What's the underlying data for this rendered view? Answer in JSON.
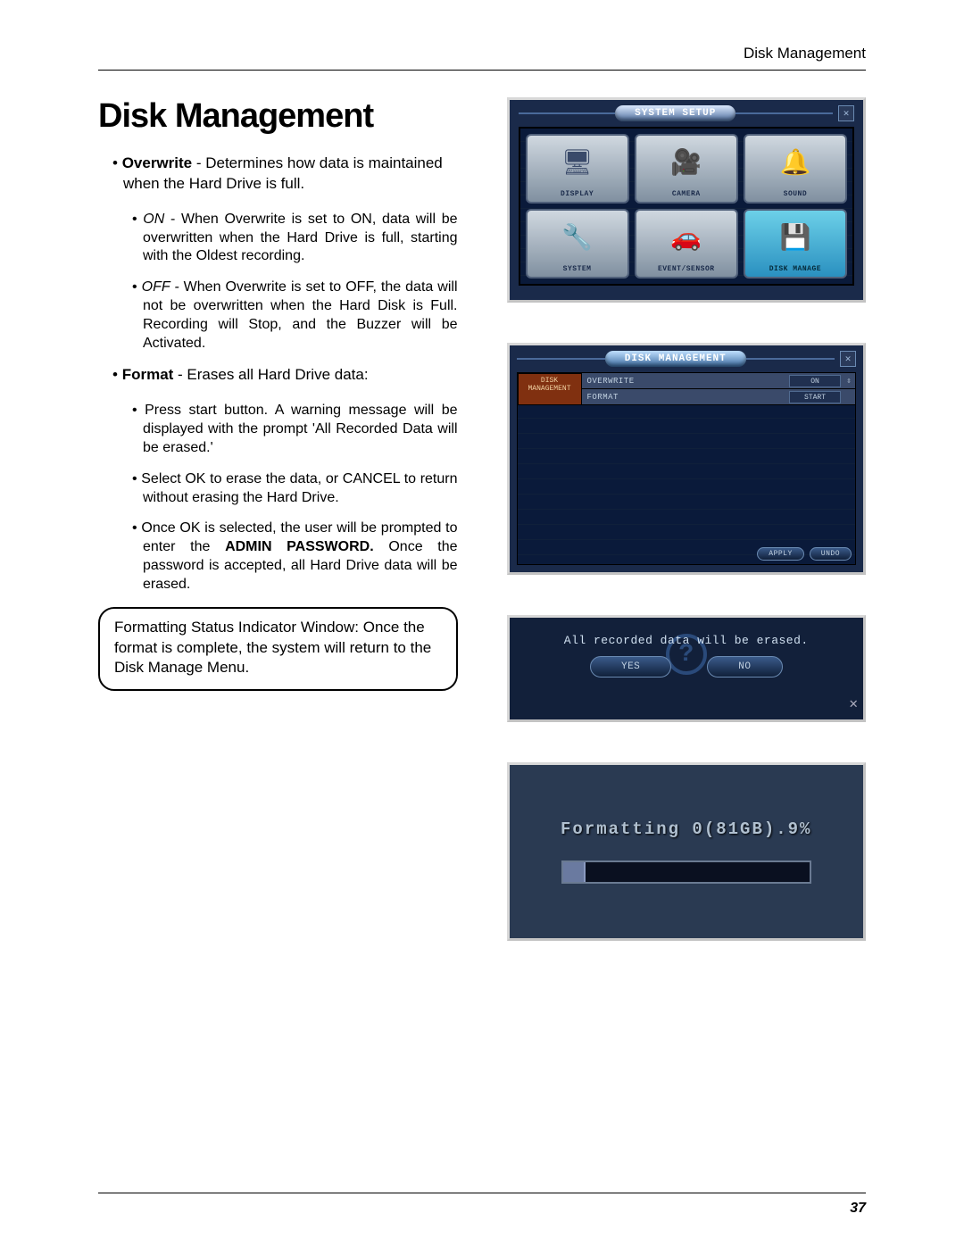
{
  "header": {
    "right": "Disk Management"
  },
  "title": "Disk Management",
  "bullets": {
    "overwrite": {
      "label": "Overwrite",
      "desc": " - Determines how data is maintained when the Hard Drive is full.",
      "on_label": "ON",
      "on_text": " - When Overwrite is set to ON, data will be overwritten when the Hard Drive is full, starting with the Oldest recording.",
      "off_label": "OFF -",
      "off_text": " When Overwrite is set to OFF, the data will not be overwritten when the Hard Disk is Full. Recording will Stop, and the Buzzer will be Activated."
    },
    "format": {
      "label": "Format",
      "desc": " - Erases all Hard Drive data:",
      "s1": "Press start button. A warning message will be displayed with the prompt 'All Recorded Data will be erased.'",
      "s2": "Select OK to erase the data, or CANCEL to return without erasing the Hard Drive.",
      "s3a": "Once OK is selected, the user will be prompted to enter the ",
      "s3b": "ADMIN PASSWORD.",
      "s3c": " Once the password is accepted, all Hard Drive data will be erased."
    }
  },
  "note": "Formatting Status Indicator Window: Once the format is complete, the system will return to the Disk Manage Menu.",
  "shot1": {
    "title": "SYSTEM SETUP",
    "tiles": [
      {
        "label": "DISPLAY",
        "icon": "🖥"
      },
      {
        "label": "CAMERA",
        "icon": "🎥"
      },
      {
        "label": "SOUND",
        "icon": "🔔"
      },
      {
        "label": "SYSTEM",
        "icon": "🔧"
      },
      {
        "label": "EVENT/SENSOR",
        "icon": "🚗"
      },
      {
        "label": "DISK MANAGE",
        "icon": "💾"
      }
    ]
  },
  "shot2": {
    "title": "DISK MANAGEMENT",
    "sidetab": "DISK MANAGEMENT",
    "rows": [
      {
        "label": "OVERWRITE",
        "value": "ON",
        "arrow": "⇳"
      },
      {
        "label": "FORMAT",
        "value": "START",
        "arrow": ""
      }
    ],
    "apply": "APPLY",
    "undo": "UNDO"
  },
  "shot3": {
    "msg": "All recorded data will be erased.",
    "yes": "YES",
    "no": "NO"
  },
  "shot4": {
    "text": "Formatting 0(81GB).9%",
    "percent": 9
  },
  "page": "37"
}
